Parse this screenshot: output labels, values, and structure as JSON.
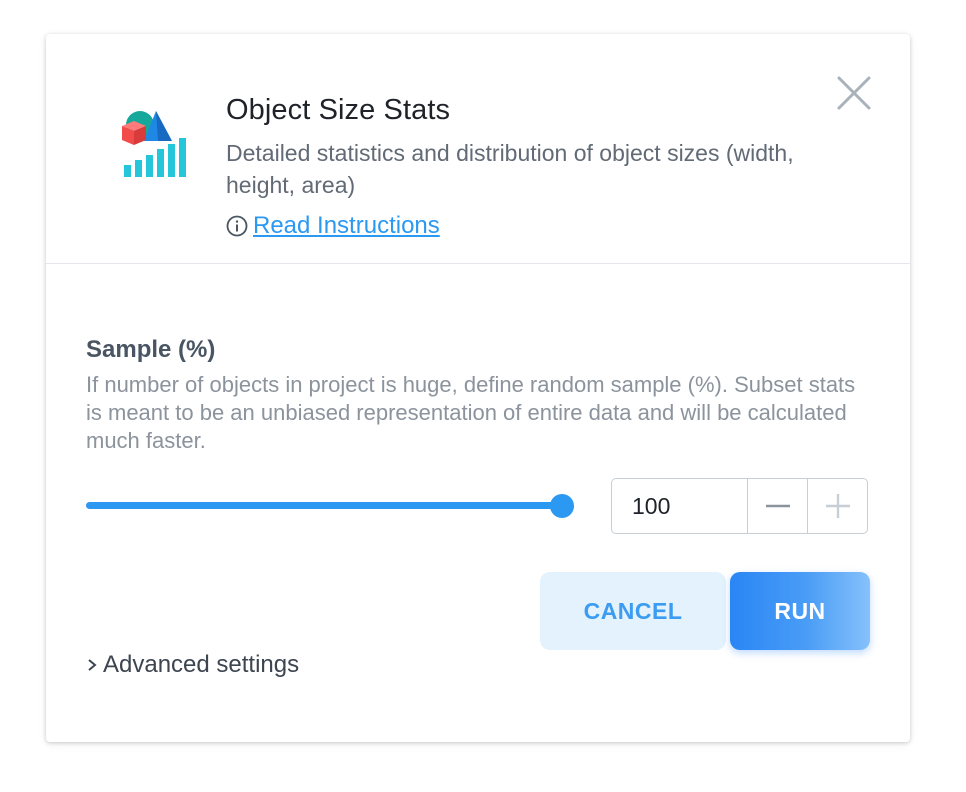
{
  "app": {
    "title": "Object Size Stats",
    "description": "Detailed statistics and distribution of object sizes (width, height, area)",
    "instructions_link": "Read Instructions",
    "icon": "object-stats-chart-icon"
  },
  "sample": {
    "label": "Sample (%)",
    "description": "If number of objects in project is huge, define random sample (%). Subset stats is meant to be an unbiased representation of entire data and will be calculated much faster.",
    "value": "100",
    "slider_percent": 100
  },
  "buttons": {
    "cancel": "CANCEL",
    "run": "RUN"
  },
  "advanced": {
    "label": "Advanced settings"
  },
  "colors": {
    "accent": "#2b98f2",
    "cancel_bg": "#e3f2fd",
    "run_gradient_start": "#2a86f5",
    "run_gradient_end": "#86c1fb"
  }
}
